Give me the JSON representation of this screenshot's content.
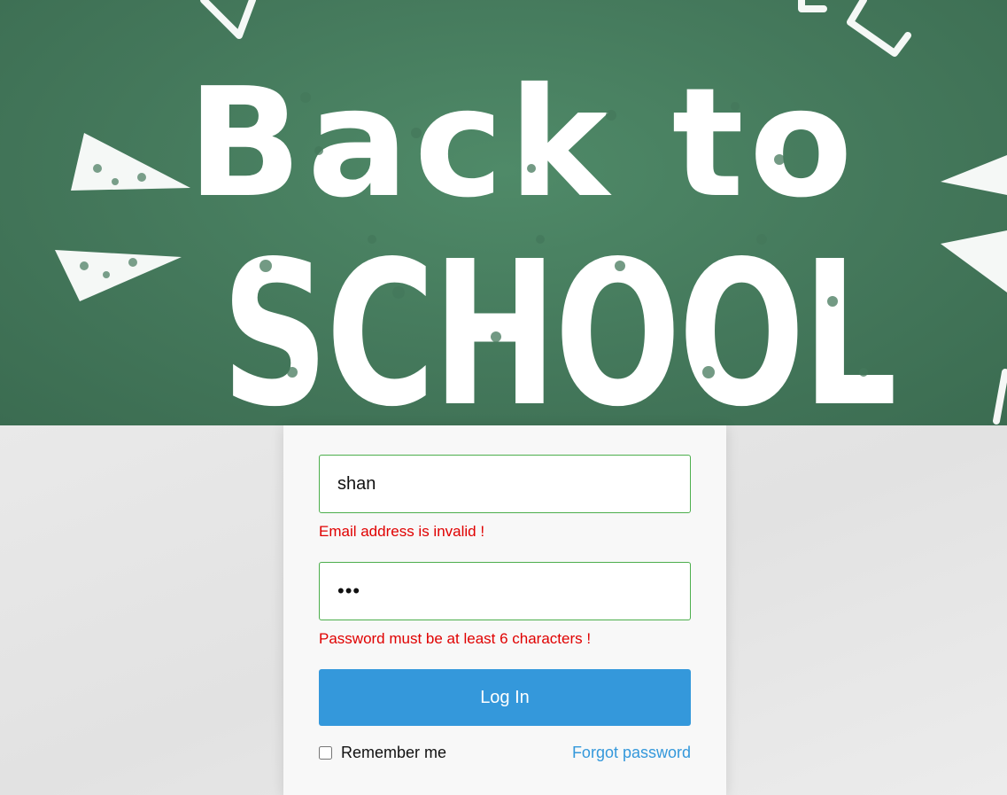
{
  "banner": {
    "line1": "Back to",
    "line2": "SCHOOL",
    "background_color": "#44785b"
  },
  "login_form": {
    "email": {
      "value": "shan",
      "error": "Email address is invalid !"
    },
    "password": {
      "value": "abc",
      "error": "Password must be at least 6 characters !"
    },
    "login_label": "Log In",
    "remember_label": "Remember me",
    "remember_checked": false,
    "forgot_label": "Forgot password"
  },
  "colors": {
    "accent": "#3498db",
    "error": "#e00000",
    "valid_border": "#4cae4c"
  }
}
